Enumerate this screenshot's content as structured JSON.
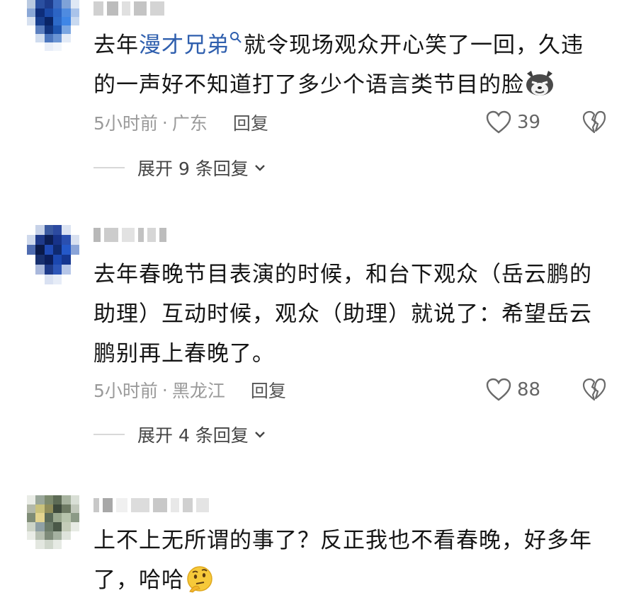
{
  "comments": [
    {
      "text_before": "去年",
      "link": "漫才兄弟",
      "text_after": "就令现场观众开心笑了一回，久违的一声好不知道打了多少个语言类节目的脸",
      "emoji": "smirk-wolf-emoji",
      "time": "5小时前",
      "sep": "·",
      "location": "广东",
      "reply": "回复",
      "likes": "39",
      "expand_text": "展开 9 条回复"
    },
    {
      "text": "去年春晚节目表演的时候，和台下观众（岳云鹏的助理）互动时候，观众（助理）就说了：希望岳云鹏别再上春晚了。",
      "time": "5小时前",
      "sep": "·",
      "location": "黑龙江",
      "reply": "回复",
      "likes": "88",
      "expand_text": "展开 4 条回复"
    },
    {
      "text": "上不上无所谓的事了？反正我也不看春晚，好多年了，哈哈",
      "emoji": "thinking-face-emoji"
    }
  ],
  "colors": {
    "link": "#2f5fae",
    "meta": "#9a9a9a",
    "text": "#151515"
  }
}
